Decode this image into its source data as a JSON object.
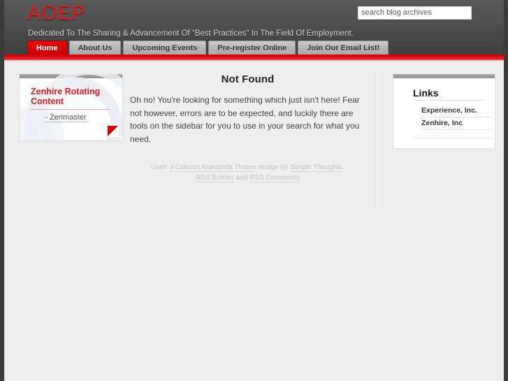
{
  "header": {
    "site_title": "AOEP",
    "tagline": "Dedicated To The Sharing & Advancement Of \"Best Practices\" In The Field Of Employment.",
    "accent_color": "#d40000",
    "background_color": "#4c4c4c",
    "search": {
      "placeholder": "search blog archives",
      "value": ""
    }
  },
  "nav": {
    "items": [
      {
        "label": "Home",
        "active": true
      },
      {
        "label": "About Us",
        "active": false
      },
      {
        "label": "Upcoming Events",
        "active": false
      },
      {
        "label": "Pre-register Online",
        "active": false
      },
      {
        "label": "Join Our Email List!",
        "active": false
      }
    ]
  },
  "left_sidebar": {
    "widget": {
      "title": "Zenhire Rotating Content",
      "author": "- Zenmaster",
      "corner_color": "#d40000"
    }
  },
  "main": {
    "title": "Not Found",
    "body": "Oh no! You're looking for something which just isn't here! Fear not however, errors are to be expected, and luckily there are tools on the sidebar for you to use in your search for what you need.",
    "credits": {
      "line1_prefix": "Uses ",
      "theme_link": "3-Column Anaconda Theme",
      "line1_middle": " design by ",
      "designer_link": "Simple Thoughts",
      "line1_suffix": ".",
      "rss_entries": "RSS Entries",
      "rss_conjunction": " and ",
      "rss_comments": "RSS Comments"
    }
  },
  "right_sidebar": {
    "links_widget": {
      "title": "Links",
      "items": [
        {
          "label": "Experience, Inc."
        },
        {
          "label": "Zenhire, Inc"
        }
      ]
    }
  }
}
